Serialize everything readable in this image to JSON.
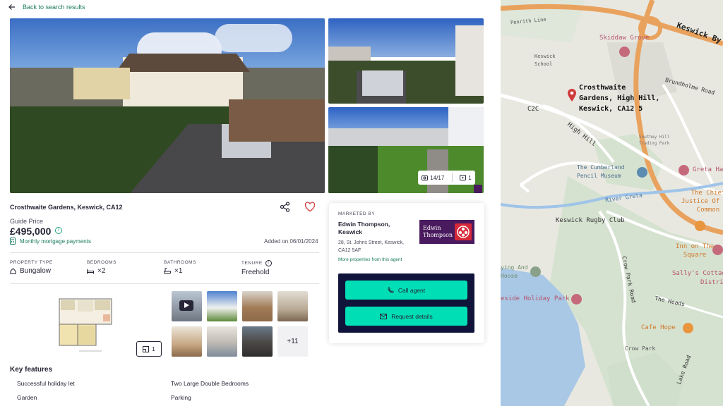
{
  "nav": {
    "back_label": "Back to search results"
  },
  "gallery": {
    "counter_photos": "14/17",
    "counter_videos": "1"
  },
  "property": {
    "address": "Crosthwaite Gardens, Keswick, CA12",
    "guide_label": "Guide Price",
    "price": "£495,000",
    "mortgage_link": "Monthly mortgage payments",
    "added_on": "Added on 06/01/2024"
  },
  "details": [
    {
      "label": "PROPERTY TYPE",
      "value": "Bungalow",
      "icon": "house-icon"
    },
    {
      "label": "BEDROOMS",
      "value": "×2",
      "icon": "bed-icon"
    },
    {
      "label": "BATHROOMS",
      "value": "×1",
      "icon": "bath-icon"
    },
    {
      "label": "TENURE",
      "value": "Freehold",
      "icon": "info-icon"
    }
  ],
  "media": {
    "floorplan_count": "1",
    "more_photos": "+11"
  },
  "key_features": {
    "title": "Key features",
    "items": [
      "Successful holiday let",
      "Two Large Double Bedrooms",
      "Garden",
      "Parking"
    ]
  },
  "agent": {
    "marketed_by": "MARKETED BY",
    "name": "Edwin Thompson, Keswick",
    "address": "28, St. Johns Street, Keswick, CA12 5AF",
    "more_link": "More properties from this agent",
    "logo_text_1": "Edwin",
    "logo_text_2": "Thompson",
    "call_label": "Call agent",
    "request_label": "Request details"
  },
  "map": {
    "pin_label_1": "Crosthwaite",
    "pin_label_2": "Gardens, High Hill,",
    "pin_label_3": "Keswick, CA12 5",
    "labels": {
      "keswick_by": "Keswick By",
      "penrith_line": "Penrith Line",
      "skiddaw_grove": "Skiddaw Grove",
      "keswick_school_1": "Keswick",
      "keswick_school_2": "School",
      "brundholme": "Brundholme Road",
      "c2c": "C2C",
      "high_hill": "High Hill",
      "southey_1": "Southey Hill",
      "southey_2": "Trading Park",
      "cumberland_1": "The Cumberland",
      "cumberland_2": "Pencil Museum",
      "greta_hall": "Greta Ha",
      "chief_1": "The Chief",
      "chief_2": "Justice Of The",
      "chief_3": "Common",
      "river_greta": "River Greta",
      "rugby": "Keswick Rugby Club",
      "inn_1": "Inn on The",
      "inn_2": "Square",
      "crow_park_road": "Crow Park Road",
      "sallys_1": "Sally's Cottages - La",
      "sallys_2": "Distric",
      "lying_1": "ying And",
      "lying_2": "Hoose",
      "holiday_park": "eside Holiday Park",
      "the_heads": "The Heads",
      "cafe_hope": "Cafe Hope",
      "crow_park": "Crow Park",
      "lake_road": "Lake Road"
    }
  },
  "colors": {
    "accent_green": "#1b7a5f",
    "cta": "#00deb6",
    "cta_panel": "#11143a",
    "agent_logo": "#4a1a5e",
    "map_pin": "#d0393a"
  }
}
